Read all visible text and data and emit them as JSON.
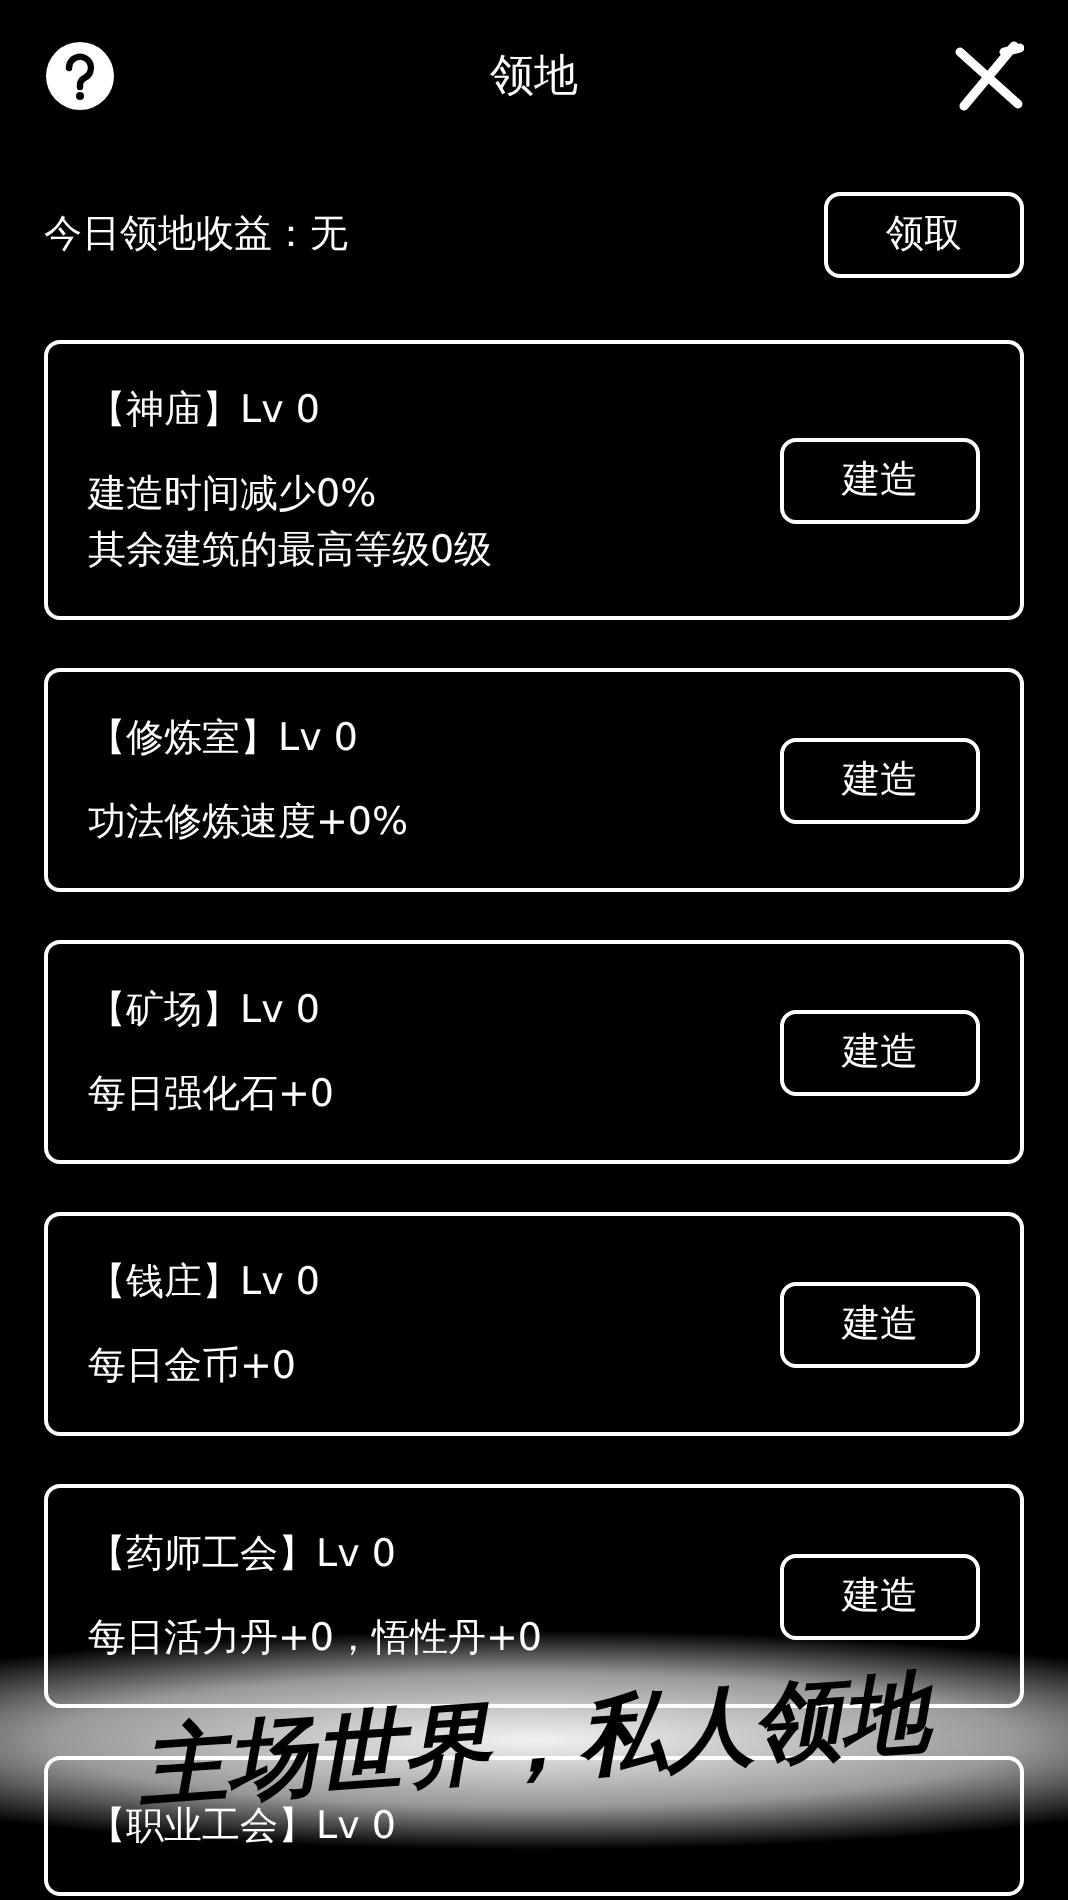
{
  "header": {
    "title": "领地"
  },
  "income": {
    "label": "今日领地收益：无",
    "button": "领取"
  },
  "buildings": [
    {
      "title": "【神庙】Lv 0",
      "lines": [
        "建造时间减少0%",
        "其余建筑的最高等级0级"
      ],
      "button": "建造"
    },
    {
      "title": "【修炼室】Lv 0",
      "lines": [
        "功法修炼速度+0%"
      ],
      "button": "建造"
    },
    {
      "title": "【矿场】Lv 0",
      "lines": [
        "每日强化石+0"
      ],
      "button": "建造"
    },
    {
      "title": "【钱庄】Lv 0",
      "lines": [
        "每日金币+0"
      ],
      "button": "建造"
    },
    {
      "title": "【药师工会】Lv 0",
      "lines": [
        "每日活力丹+0，悟性丹+0"
      ],
      "button": "建造"
    },
    {
      "title": "【职业工会】Lv 0"
    }
  ],
  "caption": "主场世界，私人领地"
}
